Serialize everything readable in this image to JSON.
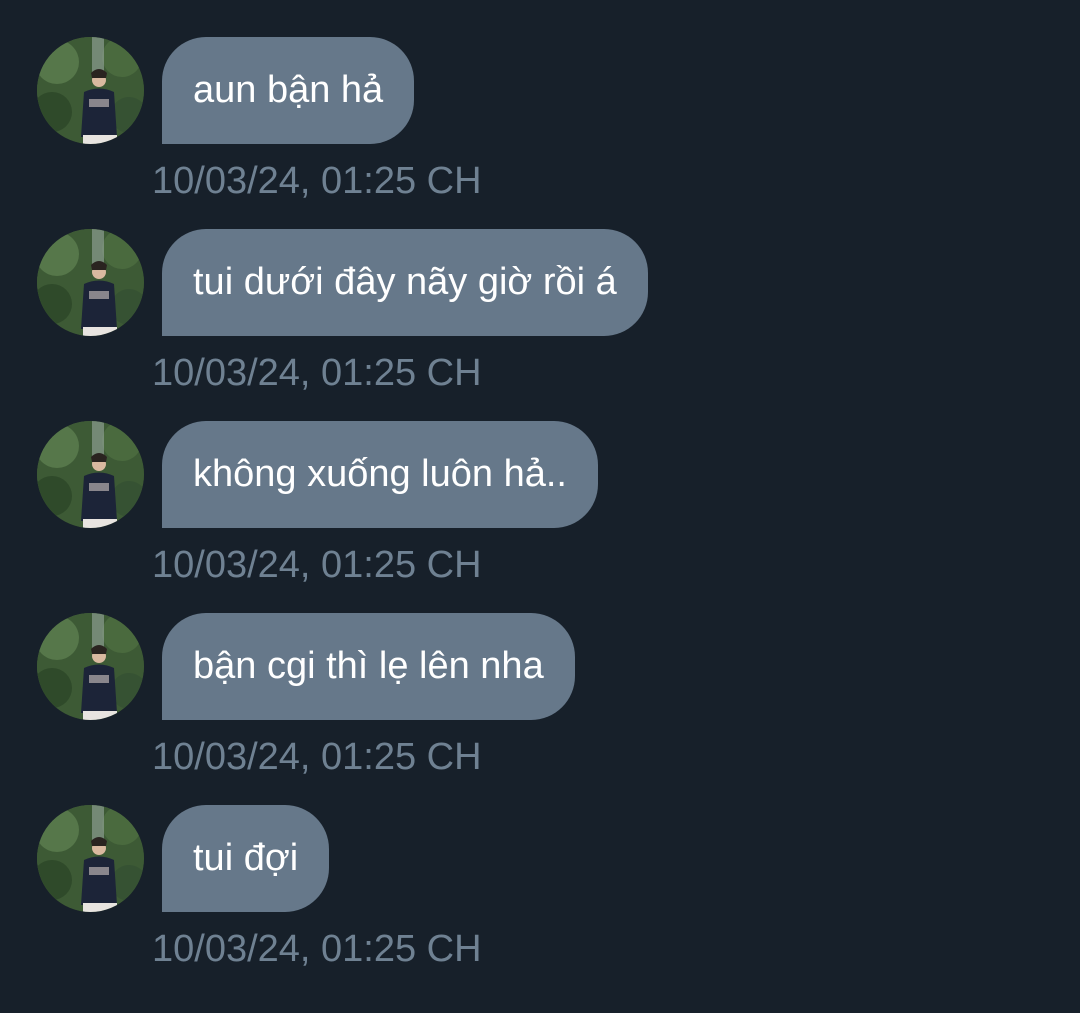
{
  "messages": [
    {
      "text": "aun bận hả",
      "timestamp": "10/03/24, 01:25 CH"
    },
    {
      "text": "tui dưới đây nãy giờ rồi á",
      "timestamp": "10/03/24, 01:25 CH"
    },
    {
      "text": "không xuống luôn hả..",
      "timestamp": "10/03/24, 01:25 CH"
    },
    {
      "text": "bận cgi thì lẹ lên nha",
      "timestamp": "10/03/24, 01:25 CH"
    },
    {
      "text": "tui đợi",
      "timestamp": "10/03/24, 01:25 CH"
    }
  ],
  "colors": {
    "background": "#17202a",
    "bubble": "#66788a",
    "bubble_text": "#ffffff",
    "timestamp": "#6f8192"
  },
  "icons": {
    "avatar": "sender-avatar-photo"
  }
}
